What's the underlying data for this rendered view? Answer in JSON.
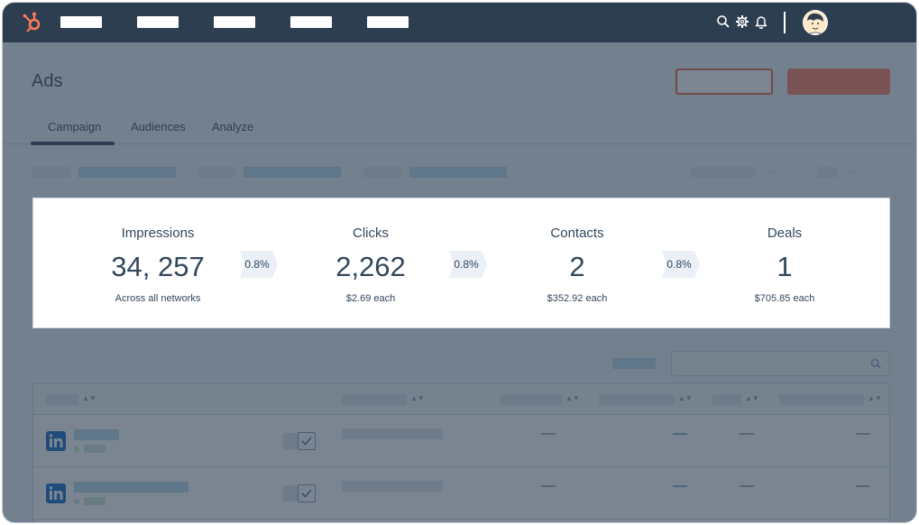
{
  "header": {
    "page_title": "Ads"
  },
  "tabs": [
    {
      "label": "Campaign",
      "active": true
    },
    {
      "label": "Audiences",
      "active": false
    },
    {
      "label": "Analyze",
      "active": false
    }
  ],
  "funnel": {
    "stages": [
      {
        "label": "Impressions",
        "value": "34, 257",
        "sub": "Across all networks"
      },
      {
        "label": "Clicks",
        "value": "2,262",
        "sub": "$2.69 each"
      },
      {
        "label": "Contacts",
        "value": "2",
        "sub": "$352.92 each"
      },
      {
        "label": "Deals",
        "value": "1",
        "sub": "$705.85 each"
      }
    ],
    "rates": [
      "0.8%",
      "0.8%",
      "0.8%"
    ]
  },
  "colors": {
    "nav_bg": "#2d3e50",
    "accent": "#ff7a59",
    "linkedin": "#0a66c2"
  },
  "icons": {
    "logo": "hubspot-sprocket-icon",
    "search": "search-icon",
    "settings": "gear-icon",
    "notifications": "bell-icon",
    "row_network": "linkedin-icon"
  }
}
